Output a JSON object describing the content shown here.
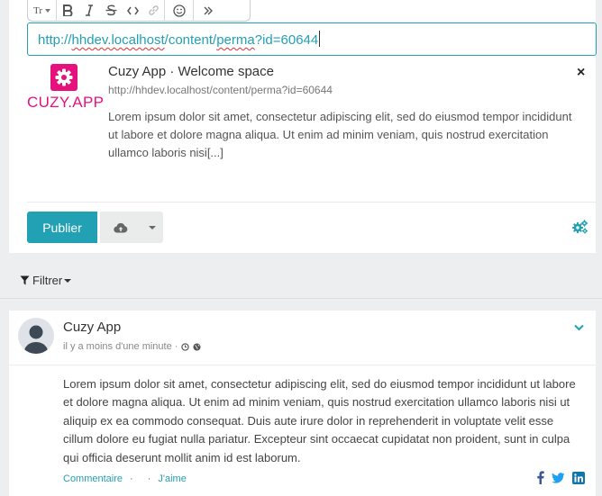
{
  "composer": {
    "toolbar": {
      "icons": [
        "text-size-icon",
        "bold-icon",
        "italic-icon",
        "strikethrough-icon",
        "code-icon",
        "link-icon",
        "emoji-icon",
        "more-icon"
      ],
      "text_size_label": "Tr"
    },
    "url_input": {
      "part1": "http://",
      "part2": "hhdev.localhost",
      "part3": "/content/",
      "part4": "perma",
      "part5": "?id=60644"
    },
    "preview": {
      "logo_text": "CUZY.APP",
      "title": "Cuzy App · Welcome space",
      "url": "http://hhdev.localhost/content/perma?id=60644",
      "description": "Lorem ipsum dolor sit amet, consectetur adipiscing elit, sed do eiusmod tempor incididunt ut labore et dolore magna aliqua. Ut enim ad minim veniam, quis nostrud exercitation ullamco laboris nisi[...]",
      "close": "×"
    },
    "publish_label": "Publier",
    "upload_icon": "cloud-upload-icon",
    "settings_icon": "cogs-icon"
  },
  "filter": {
    "label": "Filtrer",
    "icon": "filter-icon"
  },
  "post": {
    "author": "Cuzy App",
    "time": "il y a moins d'une minute · ",
    "meta_icons": [
      "clock-icon",
      "globe-icon"
    ],
    "body": "Lorem ipsum dolor sit amet, consectetur adipiscing elit, sed do eiusmod tempor incididunt ut labore et dolore magna aliqua. Ut enim ad minim veniam, quis nostrud exercitation ullamco laboris nisi ut aliquip ex ea commodo consequat. Duis aute irure dolor in reprehenderit in voluptate velit esse cillum dolore eu fugiat nulla pariatur. Excepteur sint occaecat cupidatat non proident, sunt in culpa qui officia deserunt mollit anim id est laborum.",
    "actions": {
      "comment": "Commentaire",
      "separator": "·",
      "like": "J'aime"
    },
    "share_icons": [
      "facebook-icon",
      "twitter-icon",
      "linkedin-icon"
    ]
  },
  "colors": {
    "accent": "#21a1b3",
    "brand": "#e5127d",
    "background": "#eceeef"
  }
}
